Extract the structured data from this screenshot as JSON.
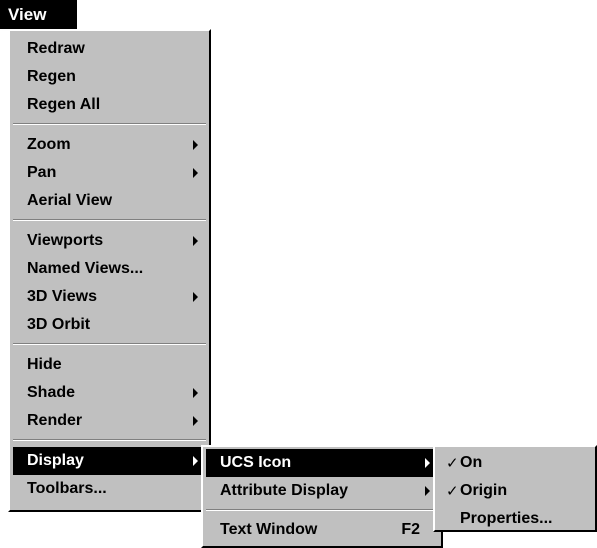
{
  "menu_title": "View",
  "view_menu": {
    "items": [
      {
        "label": "Redraw",
        "has_submenu": false
      },
      {
        "label": "Regen",
        "has_submenu": false
      },
      {
        "label": "Regen All",
        "has_submenu": false
      },
      {
        "label": "Zoom",
        "has_submenu": true
      },
      {
        "label": "Pan",
        "has_submenu": true
      },
      {
        "label": "Aerial View",
        "has_submenu": false
      },
      {
        "label": "Viewports",
        "has_submenu": true
      },
      {
        "label": "Named Views...",
        "has_submenu": false
      },
      {
        "label": "3D Views",
        "has_submenu": true
      },
      {
        "label": "3D Orbit",
        "has_submenu": false
      },
      {
        "label": "Hide",
        "has_submenu": false
      },
      {
        "label": "Shade",
        "has_submenu": true
      },
      {
        "label": "Render",
        "has_submenu": true
      },
      {
        "label": "Display",
        "has_submenu": true,
        "highlighted": true
      },
      {
        "label": "Toolbars...",
        "has_submenu": false
      }
    ]
  },
  "display_submenu": {
    "items": [
      {
        "label": "UCS Icon",
        "has_submenu": true,
        "highlighted": true
      },
      {
        "label": "Attribute Display",
        "has_submenu": true
      },
      {
        "label": "Text Window",
        "shortcut": "F2"
      }
    ]
  },
  "ucs_icon_submenu": {
    "items": [
      {
        "label": "On",
        "checked": true
      },
      {
        "label": "Origin",
        "checked": true
      },
      {
        "label": "Properties...",
        "checked": false
      }
    ]
  },
  "colors": {
    "menu_face": "#c0c0c0",
    "highlight_bg": "#000000",
    "highlight_text": "#ffffff"
  },
  "icons": {
    "submenu_arrow": "chevron-right-icon",
    "checkmark": "check-icon"
  }
}
